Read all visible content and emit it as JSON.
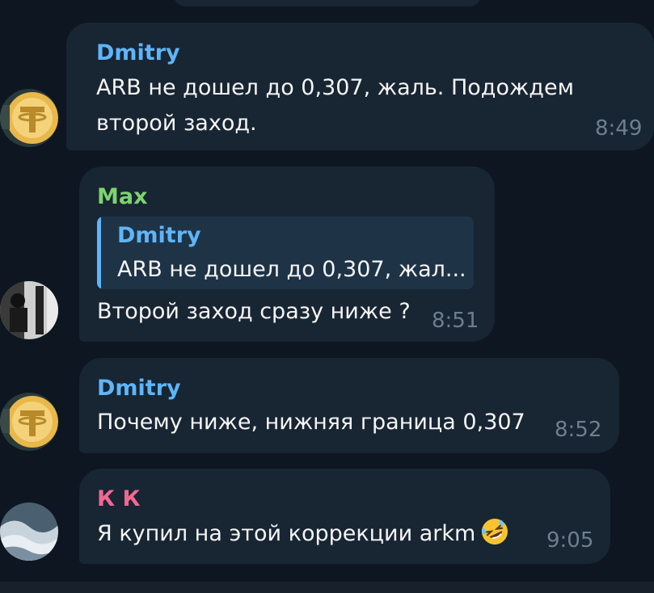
{
  "colors": {
    "background": "#0e1621",
    "bubble": "#182533",
    "name_dmitry": "#5eb5f7",
    "name_max": "#7cd46e",
    "name_kk": "#f06892",
    "time": "#6d7f8f"
  },
  "messages": [
    {
      "author": "Dmitry",
      "avatar": "tether-coin-avatar",
      "lines": [
        "ARB не дошел до 0,307, жаль. Подождем",
        "второй заход."
      ],
      "time": "8:49"
    },
    {
      "author": "Max",
      "avatar": "photo-avatar",
      "reply": {
        "author": "Dmitry",
        "text": "ARB не дошел до 0,307, жал..."
      },
      "lines": [
        "Второй заход сразу ниже ?"
      ],
      "time": "8:51"
    },
    {
      "author": "Dmitry",
      "avatar": "tether-coin-avatar",
      "lines": [
        "Почему ниже, нижняя граница 0,307"
      ],
      "time": "8:52"
    },
    {
      "author": "К К",
      "avatar": "wave-photo-avatar",
      "lines": [
        "Я купил на этой коррекции arkm"
      ],
      "emoji": "rolling-on-floor-laughing-emoji",
      "time": "9:05"
    }
  ]
}
